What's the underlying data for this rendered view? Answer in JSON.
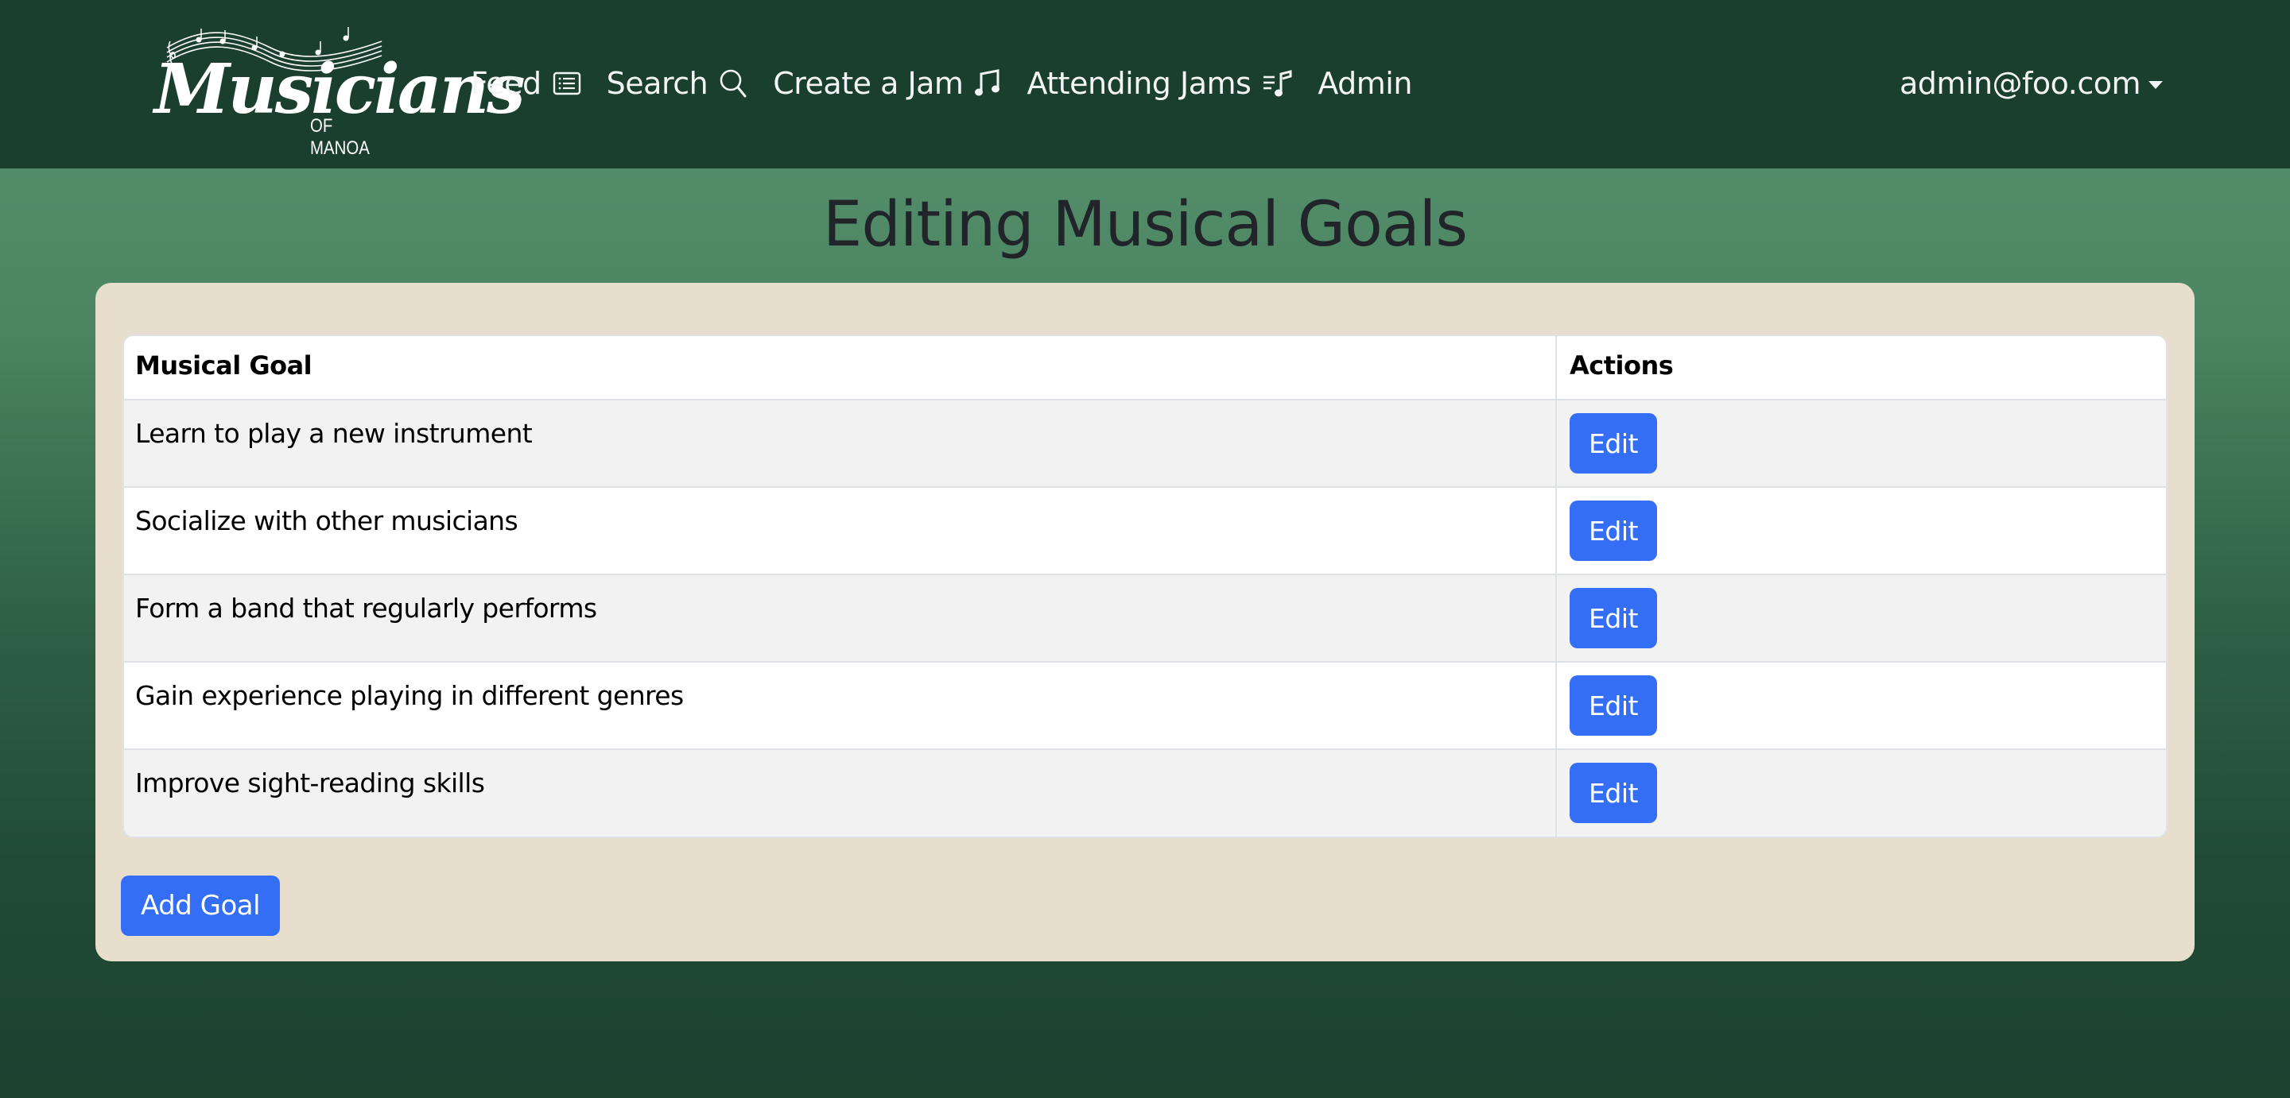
{
  "navbar": {
    "brand": {
      "name": "Musicians",
      "subtitle": "OF MANOA",
      "logo_icon": "music-staff-icon"
    },
    "links": [
      {
        "label": "Feed",
        "icon": "list-icon"
      },
      {
        "label": "Search",
        "icon": "search-icon"
      },
      {
        "label": "Create a Jam",
        "icon": "music-notes-icon"
      },
      {
        "label": "Attending Jams",
        "icon": "music-playlist-icon"
      },
      {
        "label": "Admin",
        "icon": null
      }
    ],
    "user_menu": {
      "label": "admin@foo.com",
      "icon": "caret-down-icon"
    }
  },
  "page": {
    "title": "Editing Musical Goals"
  },
  "table": {
    "columns": [
      "Musical Goal",
      "Actions"
    ],
    "rows": [
      {
        "goal": "Learn to play a new instrument",
        "action_label": "Edit"
      },
      {
        "goal": "Socialize with other musicians",
        "action_label": "Edit"
      },
      {
        "goal": "Form a band that regularly performs",
        "action_label": "Edit"
      },
      {
        "goal": "Gain experience playing in different genres",
        "action_label": "Edit"
      },
      {
        "goal": "Improve sight-reading skills",
        "action_label": "Edit"
      }
    ]
  },
  "actions": {
    "add_goal_label": "Add Goal"
  },
  "colors": {
    "navbar_bg": "#1b3f2e",
    "card_bg": "#e8dece",
    "primary_button": "#346ef5",
    "title_text": "#212529",
    "stripe_row": "#f2f2f2"
  }
}
